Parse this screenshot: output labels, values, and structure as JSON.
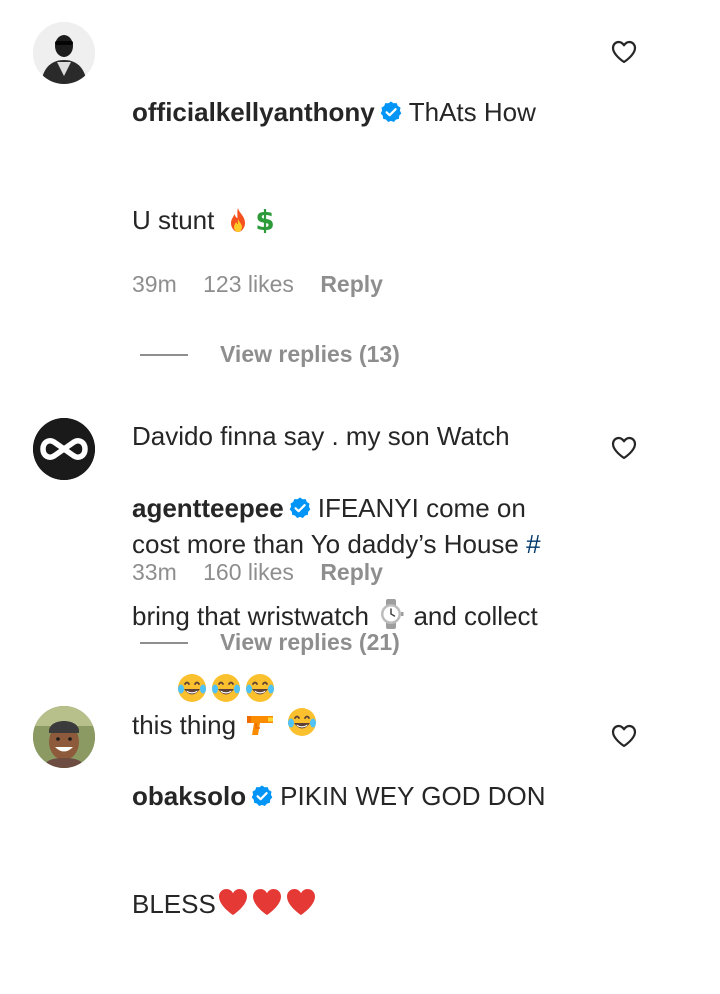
{
  "comments": [
    {
      "username": "officialkellyanthony",
      "text_line1": "ThAts How",
      "text_line2": "U stunt",
      "text_para2_line1": "Davido finna say . my son Watch",
      "text_para2_line2": "cost more than Yo daddy’s House",
      "hashtag": "#",
      "emojis_line2": [
        "fire",
        "dollar"
      ],
      "emojis_trailing": [
        "laugh-cry",
        "laugh-cry",
        "laugh-cry"
      ],
      "time": "39m",
      "likes": "123 likes",
      "reply_label": "Reply",
      "view_replies": "View replies (13)"
    },
    {
      "username": "agentteepee",
      "text_line1": "IFEANYI come on",
      "text_line2a": "bring that wristwatch",
      "text_line2b": "and collect",
      "text_line3": "this thing",
      "time": "33m",
      "likes": "160 likes",
      "reply_label": "Reply",
      "view_replies": "View replies (21)"
    },
    {
      "username": "obaksolo",
      "text_line1": "PIKIN WEY GOD DON",
      "text_line2": "BLESS"
    }
  ],
  "colors": {
    "text": "#262626",
    "secondary": "#8e8e8e",
    "verified": "#0095f6",
    "hashtag": "#00376b"
  }
}
